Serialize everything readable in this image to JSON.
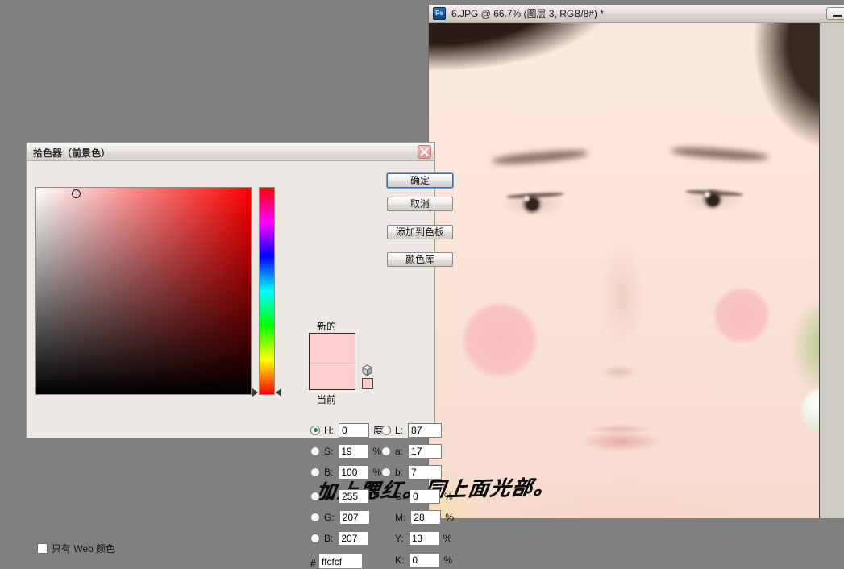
{
  "desktop": {
    "background_color": "#808080"
  },
  "photoshop_window": {
    "icon": "photoshop-ps-icon",
    "title": "6.JPG @ 66.7% (图层 3, RGB/8#) *",
    "minimize_label": "",
    "document_name": "6.JPG",
    "zoom_level": "66.7%",
    "layer_name": "图层 3",
    "color_mode": "RGB/8#",
    "modified_marker": "*"
  },
  "annotation": {
    "text": "加上腮红。同上面光部。"
  },
  "picker": {
    "title": "拾色器（前景色）",
    "close_icon": "close-icon",
    "web_only_label": "只有 Web 颜色",
    "web_only_checked": false,
    "new_label": "新的",
    "current_label": "当前",
    "new_color": "#ffcfcf",
    "current_color": "#ffcfcf",
    "websafe_color": "#ffcccc",
    "gamut_icon": "gamut-cube-icon",
    "buttons": {
      "ok": "确定",
      "cancel": "取消",
      "add_to_swatches": "添加到色板",
      "color_libraries": "颜色库"
    },
    "selected_model": "H",
    "fields": {
      "hsb": [
        {
          "key": "H",
          "label": "H:",
          "value": "0",
          "unit": "度",
          "selected": true
        },
        {
          "key": "S",
          "label": "S:",
          "value": "19",
          "unit": "%",
          "selected": false
        },
        {
          "key": "B",
          "label": "B:",
          "value": "100",
          "unit": "%",
          "selected": false
        }
      ],
      "rgb": [
        {
          "key": "R",
          "label": "R:",
          "value": "255",
          "unit": "",
          "selected": false
        },
        {
          "key": "G",
          "label": "G:",
          "value": "207",
          "unit": "",
          "selected": false
        },
        {
          "key": "B",
          "label": "B:",
          "value": "207",
          "unit": "",
          "selected": false
        }
      ],
      "lab": [
        {
          "key": "L",
          "label": "L:",
          "value": "87",
          "unit": "",
          "selected": false
        },
        {
          "key": "a",
          "label": "a:",
          "value": "17",
          "unit": "",
          "selected": false
        },
        {
          "key": "b",
          "label": "b:",
          "value": "7",
          "unit": "",
          "selected": false
        }
      ],
      "cmyk": [
        {
          "key": "C",
          "label": "C:",
          "value": "0",
          "unit": "%"
        },
        {
          "key": "M",
          "label": "M:",
          "value": "28",
          "unit": "%"
        },
        {
          "key": "Y",
          "label": "Y:",
          "value": "13",
          "unit": "%"
        },
        {
          "key": "K",
          "label": "K:",
          "value": "0",
          "unit": "%"
        }
      ],
      "hex": {
        "prefix": "#",
        "value": "ffcfcf"
      }
    }
  }
}
